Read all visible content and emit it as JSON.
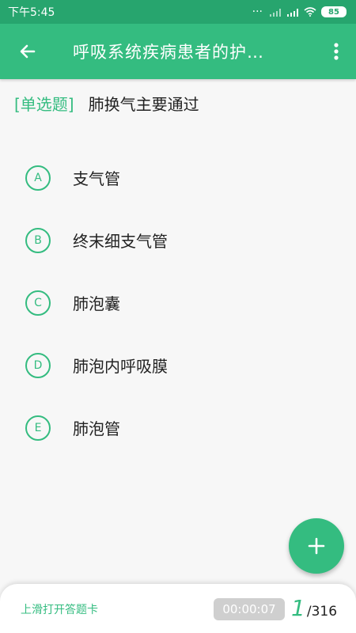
{
  "status_bar": {
    "time": "下午5:45",
    "dots": "···",
    "battery": "85",
    "icons": [
      "hd-signal-icon",
      "signal-icon",
      "wifi-icon",
      "battery-icon"
    ]
  },
  "app_bar": {
    "title": "呼吸系统疾病患者的护…",
    "back_icon": "arrow-left-icon",
    "menu_icon": "more-vertical-icon"
  },
  "question": {
    "type": "[单选题]",
    "text": "肺换气主要通过"
  },
  "options": [
    {
      "letter": "A",
      "text": "支气管"
    },
    {
      "letter": "B",
      "text": "终末细支气管"
    },
    {
      "letter": "C",
      "text": "肺泡囊"
    },
    {
      "letter": "D",
      "text": "肺泡内呼吸膜"
    },
    {
      "letter": "E",
      "text": "肺泡管"
    }
  ],
  "fab": {
    "icon": "plus-icon"
  },
  "bottom": {
    "hint": "上滑打开答题卡",
    "timer": "00:00:07",
    "current": "1",
    "sep": "/",
    "total": "316"
  },
  "colors": {
    "primary": "#34bc80",
    "status_bar": "#27a56e",
    "text": "#222222"
  }
}
